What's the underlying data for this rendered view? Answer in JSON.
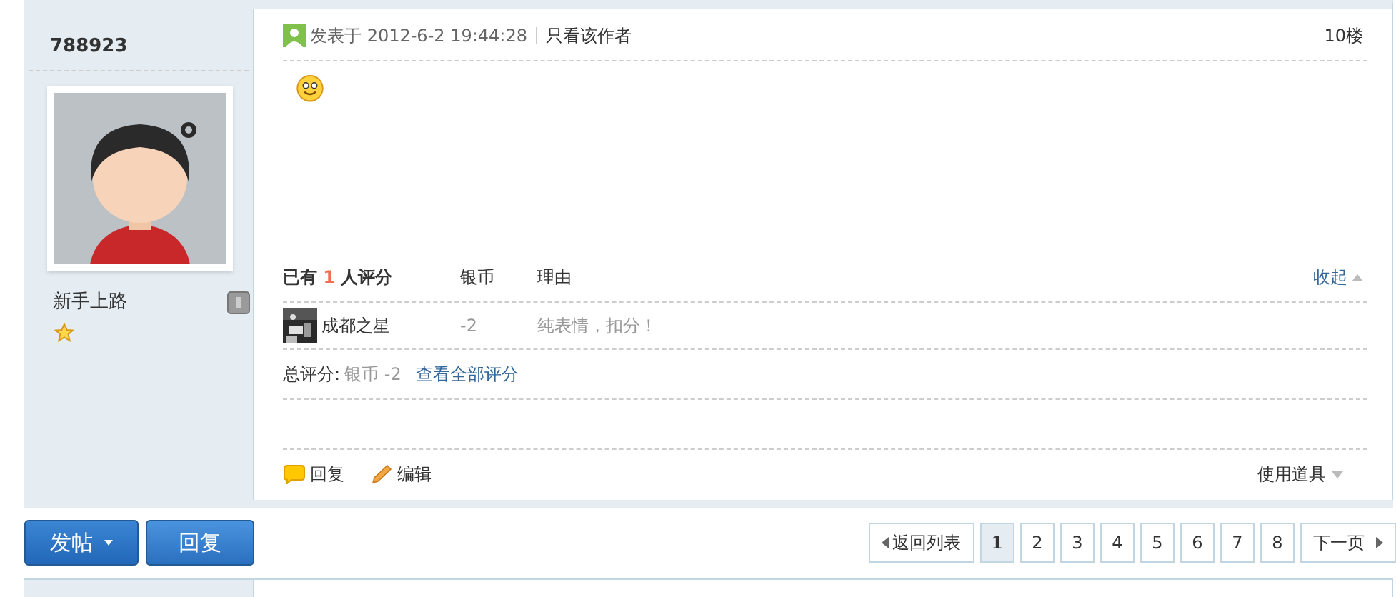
{
  "post": {
    "author": "788923",
    "rank": "新手上路",
    "meta": {
      "posted": "发表于 2012-6-2 19:44:28",
      "author_only": "只看该作者",
      "floor": "10楼"
    },
    "rating": {
      "header_prefix": "已有",
      "count": "1",
      "header_suffix": "人评分",
      "col_coins": "银币",
      "col_reason": "理由",
      "collapse": "收起",
      "rows": [
        {
          "user": "成都之星",
          "coins": "-2",
          "reason": "纯表情，扣分！"
        }
      ],
      "total_label": "总评分:",
      "total_value": "银币 -2",
      "view_all": "查看全部评分"
    },
    "actions": [
      {
        "kind": "reply",
        "label": "回复"
      },
      {
        "kind": "edit",
        "label": "编辑"
      }
    ],
    "tools": "使用道具"
  },
  "buttons": {
    "post": "发帖",
    "reply": "回复"
  },
  "pagination": {
    "back": "返回列表",
    "pages": [
      {
        "label": "1",
        "selected": true
      },
      {
        "label": "2",
        "selected": false
      },
      {
        "label": "3",
        "selected": false
      },
      {
        "label": "4",
        "selected": false
      },
      {
        "label": "5",
        "selected": false
      },
      {
        "label": "6",
        "selected": false
      },
      {
        "label": "7",
        "selected": false
      },
      {
        "label": "8",
        "selected": false
      }
    ],
    "next": "下一页"
  }
}
